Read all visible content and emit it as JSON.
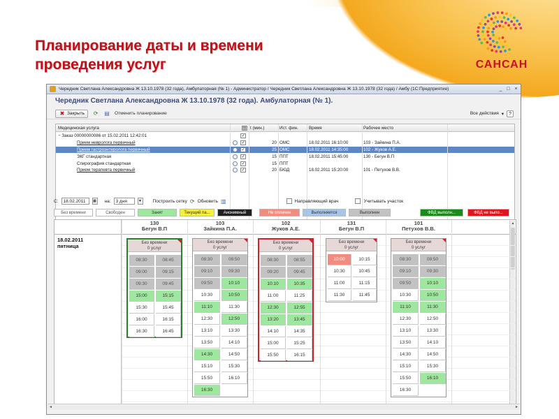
{
  "slide": {
    "title_line1": "Планирование даты и времени",
    "title_line2": "проведения услуг",
    "logo_text": "САНСАН",
    "accent": "#c0101a"
  },
  "window": {
    "title": "Чередник Светлана Александровна Ж 13.10.1978 (32 года), Амбулаторная (№ 1) - Администратор / Чередник Светлана Александровна Ж 13.10.1978 (32 года) / Амбу   (1С:Предприятие)",
    "doc_title": "Чередник Светлана Александровна Ж 13.10.1978 (32 года). Амбулаторная (№ 1).",
    "toolbar": {
      "close_label": "Закрыть",
      "cancel_planning_label": "Отменить планирование",
      "all_actions_label": "Все действия",
      "help_label": "?"
    }
  },
  "services": {
    "headers": {
      "name": "Медицинская услуга",
      "t": "t (мин.)",
      "fin": "Ист. фин.",
      "time": "Время",
      "place": "Рабочее место"
    },
    "rows": [
      {
        "name": "Заказ 00000000086 от 15.02.2011 12:42:01",
        "t": "",
        "fin": "",
        "time": "",
        "place": "",
        "checked": "✓",
        "type": "group"
      },
      {
        "name": "Прием невролога первичный",
        "t": "20",
        "fin": "ОМС",
        "time": "18.02.2011 16:10:00",
        "place": "103 - Зайкина П.А.",
        "checked": "✓",
        "type": "link"
      },
      {
        "name": "Прием гастроэнтеролога первичный",
        "t": "25",
        "fin": "ОМС",
        "time": "18.02.2011 14:35:00",
        "place": "102 - Жуков А.Е.",
        "checked": "✓",
        "type": "selected"
      },
      {
        "name": "ЭКГ стандартная",
        "t": "15",
        "fin": "ППТ",
        "time": "18.02.2011 15:45:00",
        "place": "130 - Бегун В.П",
        "checked": "✓",
        "type": "plain"
      },
      {
        "name": "Спирография стандартная",
        "t": "15",
        "fin": "ППТ",
        "time": "",
        "place": "",
        "checked": "✓",
        "type": "plain"
      },
      {
        "name": "Прием терапевта первичный",
        "t": "20",
        "fin": "БЮД",
        "time": "18.02.2011 15:20:00",
        "place": "101 - Петухов В.В.",
        "checked": "✓",
        "type": "link"
      }
    ]
  },
  "filters": {
    "from_label": "С:",
    "from_value": "18.02.2011",
    "on_label": "на:",
    "period_value": "3 дня",
    "build_grid_label": "Построить сетку",
    "refresh_label": "Обновить",
    "directing_doctor_label": "Направляющий врач",
    "consider_area_label": "Учитывать участок"
  },
  "legend": [
    {
      "label": "Без времени",
      "bg": "#ffffff",
      "fg": "#555555"
    },
    {
      "label": "Свободен",
      "bg": "#ffffff",
      "fg": "#555555"
    },
    {
      "label": "Занят",
      "bg": "#9ee79e",
      "fg": "#333333"
    },
    {
      "label": "Текущий па...",
      "bg": "#f7ef40",
      "fg": "#333333"
    },
    {
      "label": "Анонимный",
      "bg": "#202020",
      "fg": "#ffffff"
    },
    {
      "label": "Не оплачен",
      "bg": "#f08c80",
      "fg": "#ffffff"
    },
    {
      "label": "Выполняется",
      "bg": "#a8c4e6",
      "fg": "#333333"
    },
    {
      "label": "Выполнен",
      "bg": "#c2c2c2",
      "fg": "#333333"
    },
    {
      "label": "ФВД выполн...",
      "bg": "#1a8a1a",
      "fg": "#ffffff"
    },
    {
      "label": "ФВД не выпо...",
      "bg": "#e0141c",
      "fg": "#ffffff"
    }
  ],
  "schedule": {
    "date_line1": "18.02.2011",
    "date_line2": "пятница",
    "no_time_line1": "Без времени",
    "no_time_line2": "0 услуг",
    "columns": [
      {
        "room": "130",
        "doctor": "Бегун В.П",
        "frame": "green",
        "slots": [
          [
            "08:30",
            "busy"
          ],
          [
            "08:45",
            "busy"
          ],
          [
            "09:00",
            "busy"
          ],
          [
            "09:15",
            "busy"
          ],
          [
            "09:30",
            "busy"
          ],
          [
            "09:45",
            "busy"
          ],
          [
            "15:00",
            "green"
          ],
          [
            "15:15",
            "green"
          ],
          [
            "15:30",
            "free"
          ],
          [
            "15:45",
            "free"
          ],
          [
            "16:00",
            "free"
          ],
          [
            "16:15",
            "free"
          ],
          [
            "16:30",
            "free"
          ],
          [
            "16:45",
            "free"
          ]
        ]
      },
      {
        "room": "103",
        "doctor": "Зайкина П.А.",
        "frame": "plain",
        "slots": [
          [
            "08:30",
            "busy"
          ],
          [
            "08:50",
            "busy"
          ],
          [
            "09:10",
            "busy"
          ],
          [
            "09:30",
            "busy"
          ],
          [
            "09:50",
            "busy"
          ],
          [
            "10:10",
            "green"
          ],
          [
            "10:30",
            "free"
          ],
          [
            "10:50",
            "green"
          ],
          [
            "11:10",
            "green"
          ],
          [
            "11:30",
            "free"
          ],
          [
            "12:30",
            "free"
          ],
          [
            "12:50",
            "green"
          ],
          [
            "13:10",
            "free"
          ],
          [
            "13:30",
            "free"
          ],
          [
            "13:50",
            "free"
          ],
          [
            "14:10",
            "free"
          ],
          [
            "14:30",
            "green"
          ],
          [
            "14:50",
            "free"
          ],
          [
            "15:10",
            "free"
          ],
          [
            "15:30",
            "free"
          ],
          [
            "15:50",
            "free"
          ],
          [
            "16:10",
            "free"
          ],
          [
            "16:30",
            "green"
          ]
        ]
      },
      {
        "room": "102",
        "doctor": "Жуков А.Е.",
        "frame": "red",
        "slots": [
          [
            "08:30",
            "busy"
          ],
          [
            "08:55",
            "busy"
          ],
          [
            "09:20",
            "busy"
          ],
          [
            "09:45",
            "busy"
          ],
          [
            "10:10",
            "green"
          ],
          [
            "10:35",
            "green"
          ],
          [
            "11:00",
            "free"
          ],
          [
            "11:25",
            "free"
          ],
          [
            "12:30",
            "green"
          ],
          [
            "12:55",
            "green"
          ],
          [
            "13:20",
            "green"
          ],
          [
            "13:45",
            "green"
          ],
          [
            "14:10",
            "free"
          ],
          [
            "14:35",
            "free"
          ],
          [
            "15:00",
            "free"
          ],
          [
            "15:25",
            "free"
          ],
          [
            "15:50",
            "free"
          ],
          [
            "16:15",
            "free"
          ]
        ]
      },
      {
        "room": "131",
        "doctor": "Бегун В.П",
        "frame": "plain",
        "slots": [
          [
            "10:00",
            "red"
          ],
          [
            "10:15",
            "free"
          ],
          [
            "10:30",
            "free"
          ],
          [
            "10:45",
            "free"
          ],
          [
            "11:00",
            "free"
          ],
          [
            "11:15",
            "free"
          ],
          [
            "11:30",
            "free"
          ],
          [
            "11:45",
            "free"
          ]
        ]
      },
      {
        "room": "101",
        "doctor": "Петухов В.В.",
        "frame": "plain",
        "slots": [
          [
            "08:30",
            "busy"
          ],
          [
            "08:50",
            "busy"
          ],
          [
            "09:10",
            "busy"
          ],
          [
            "09:30",
            "busy"
          ],
          [
            "09:50",
            "busy"
          ],
          [
            "10:10",
            "green"
          ],
          [
            "10:30",
            "free"
          ],
          [
            "10:50",
            "green"
          ],
          [
            "11:10",
            "green"
          ],
          [
            "11:30",
            "green"
          ],
          [
            "12:30",
            "free"
          ],
          [
            "12:50",
            "free"
          ],
          [
            "13:10",
            "free"
          ],
          [
            "13:30",
            "free"
          ],
          [
            "13:50",
            "free"
          ],
          [
            "14:10",
            "free"
          ],
          [
            "14:30",
            "free"
          ],
          [
            "14:50",
            "free"
          ],
          [
            "15:10",
            "free"
          ],
          [
            "15:30",
            "free"
          ],
          [
            "15:50",
            "free"
          ],
          [
            "16:10",
            "green"
          ],
          [
            "16:30",
            "free"
          ]
        ]
      }
    ]
  }
}
